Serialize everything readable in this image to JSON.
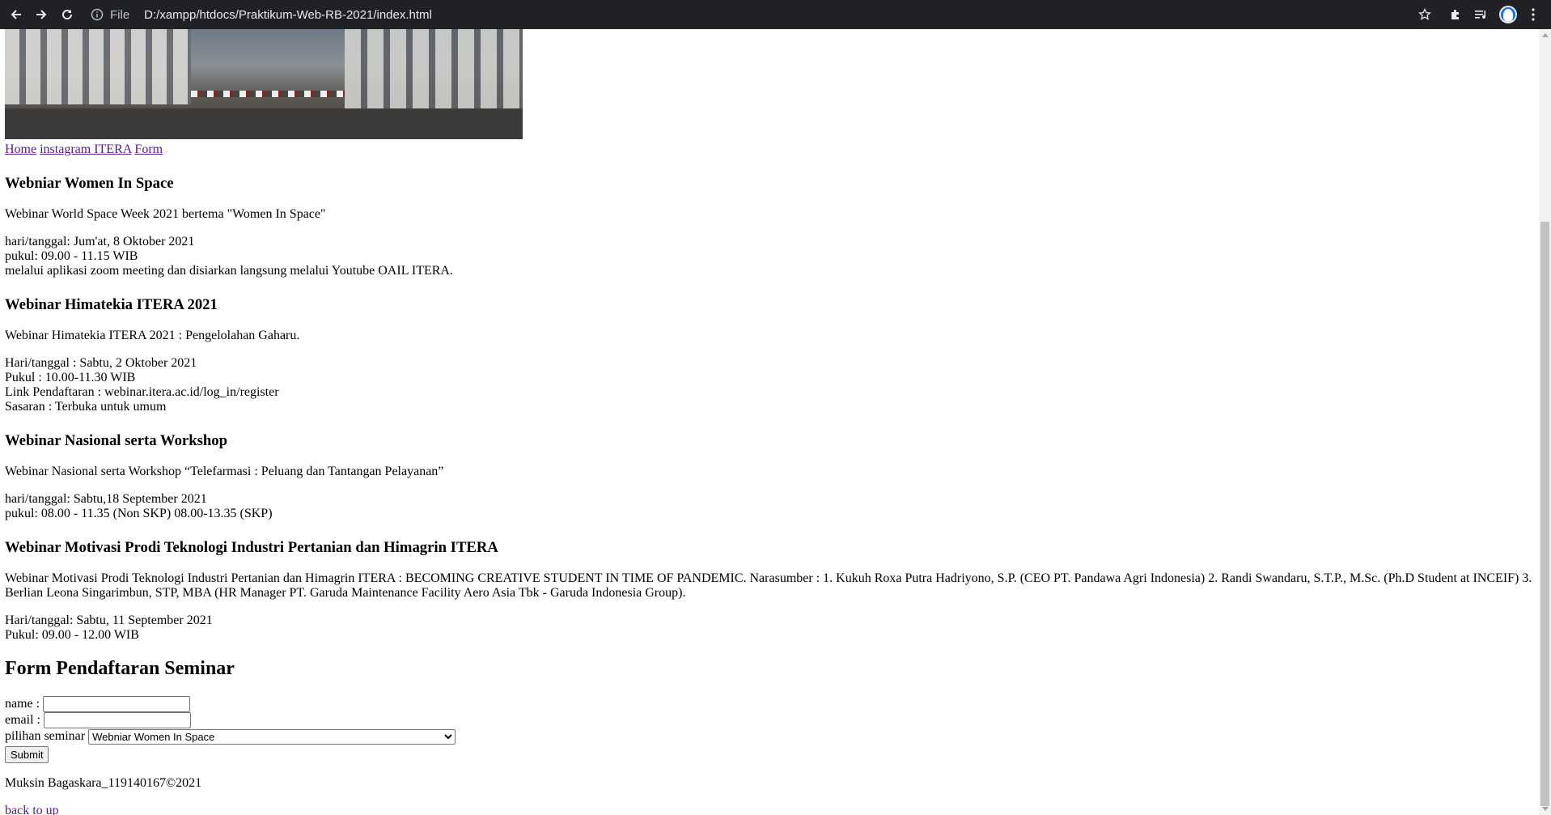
{
  "browser": {
    "file_label": "File",
    "url": "D:/xampp/htdocs/Praktikum-Web-RB-2021/index.html"
  },
  "nav": {
    "home": "Home",
    "instagram": "instagram ITERA",
    "form": "Form"
  },
  "events": [
    {
      "title": "Webniar Women In Space",
      "description": "Webinar World Space Week 2021 bertema \"Women In Space\"",
      "details": [
        "hari/tanggal: Jum'at, 8 Oktober 2021",
        "pukul: 09.00 - 11.15 WIB",
        "melalui aplikasi zoom meeting dan disiarkan langsung melalui Youtube OAIL ITERA."
      ]
    },
    {
      "title": "Webinar Himatekia ITERA 2021",
      "description": "Webinar Himatekia ITERA 2021 : Pengelolahan Gaharu.",
      "details": [
        "Hari/tanggal : Sabtu, 2 Oktober 2021",
        "Pukul : 10.00-11.30 WIB",
        "Link Pendaftaran : webinar.itera.ac.id/log_in/register",
        "Sasaran : Terbuka untuk umum"
      ]
    },
    {
      "title": "Webinar Nasional serta Workshop",
      "description": "Webinar Nasional serta Workshop “Telefarmasi : Peluang dan Tantangan Pelayanan”",
      "details": [
        "hari/tanggal: Sabtu,18 September 2021",
        "pukul: 08.00 - 11.35 (Non SKP) 08.00-13.35 (SKP)"
      ]
    },
    {
      "title": "Webinar Motivasi Prodi Teknologi Industri Pertanian dan Himagrin ITERA",
      "description": "Webinar Motivasi Prodi Teknologi Industri Pertanian dan Himagrin ITERA : BECOMING CREATIVE STUDENT IN TIME OF PANDEMIC. Narasumber : 1. Kukuh Roxa Putra Hadriyono, S.P. (CEO PT. Pandawa Agri Indonesia) 2. Randi Swandaru, S.T.P., M.Sc. (Ph.D Student at INCEIF) 3. Berlian Leona Singarimbun, STP, MBA (HR Manager PT. Garuda Maintenance Facility Aero Asia Tbk - Garuda Indonesia Group).",
      "details": [
        "Hari/tanggal: Sabtu, 11 September 2021",
        "Pukul: 09.00 - 12.00 WIB"
      ]
    }
  ],
  "form": {
    "heading": "Form Pendaftaran Seminar",
    "name_label": "name :",
    "name_value": "",
    "email_label": "email :",
    "email_value": "",
    "seminar_label": "pilihan seminar",
    "seminar_selected": "Webniar Women In Space",
    "submit_label": "Submit"
  },
  "footer": {
    "credit": "Muksin Bagaskara_119140167©2021",
    "back_to_up": "back to up"
  }
}
